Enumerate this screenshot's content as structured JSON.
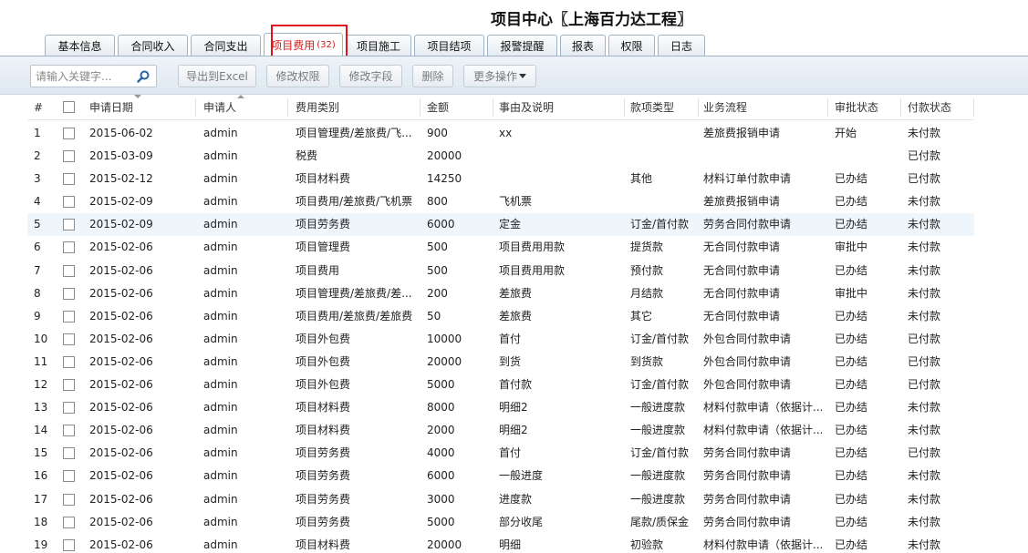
{
  "page": {
    "title": "项目中心〖上海百力达工程〗"
  },
  "tabs": [
    {
      "label": "基本信息",
      "count": ""
    },
    {
      "label": "合同收入",
      "count": ""
    },
    {
      "label": "合同支出",
      "count": ""
    },
    {
      "label": "项目费用",
      "count": "(32)",
      "active": true
    },
    {
      "label": "项目施工",
      "count": ""
    },
    {
      "label": "项目结项",
      "count": ""
    },
    {
      "label": "报警提醒",
      "count": ""
    },
    {
      "label": "报表",
      "count": ""
    },
    {
      "label": "权限",
      "count": ""
    },
    {
      "label": "日志",
      "count": ""
    }
  ],
  "toolbar": {
    "search_placeholder": "请输入关键字...",
    "export_label": "导出到Excel",
    "permission_label": "修改权限",
    "field_label": "修改字段",
    "delete_label": "删除",
    "more_label": "更多操作"
  },
  "table": {
    "columns": [
      "#",
      "申请日期",
      "申请人",
      "费用类别",
      "金额",
      "事由及说明",
      "款项类型",
      "业务流程",
      "审批状态",
      "付款状态"
    ],
    "rows": [
      [
        "1",
        "2015-06-02",
        "admin",
        "项目管理费/差旅费/飞...",
        "900",
        "xx",
        "",
        "差旅费报销申请",
        "开始",
        "未付款"
      ],
      [
        "2",
        "2015-03-09",
        "admin",
        "税费",
        "20000",
        "",
        "",
        "",
        "",
        "已付款"
      ],
      [
        "3",
        "2015-02-12",
        "admin",
        "项目材料费",
        "14250",
        "",
        "其他",
        "材料订单付款申请",
        "已办结",
        "已付款"
      ],
      [
        "4",
        "2015-02-09",
        "admin",
        "项目费用/差旅费/飞机票",
        "800",
        "飞机票",
        "",
        "差旅费报销申请",
        "已办结",
        "未付款"
      ],
      [
        "5",
        "2015-02-09",
        "admin",
        "项目劳务费",
        "6000",
        "定金",
        "订金/首付款",
        "劳务合同付款申请",
        "已办结",
        "未付款"
      ],
      [
        "6",
        "2015-02-06",
        "admin",
        "项目管理费",
        "500",
        "项目费用用款",
        "提货款",
        "无合同付款申请",
        "审批中",
        "未付款"
      ],
      [
        "7",
        "2015-02-06",
        "admin",
        "项目费用",
        "500",
        "项目费用用款",
        "预付款",
        "无合同付款申请",
        "已办结",
        "未付款"
      ],
      [
        "8",
        "2015-02-06",
        "admin",
        "项目管理费/差旅费/差...",
        "200",
        "差旅费",
        "月结款",
        "无合同付款申请",
        "审批中",
        "未付款"
      ],
      [
        "9",
        "2015-02-06",
        "admin",
        "项目费用/差旅费/差旅费",
        "50",
        "差旅费",
        "其它",
        "无合同付款申请",
        "已办结",
        "未付款"
      ],
      [
        "10",
        "2015-02-06",
        "admin",
        "项目外包费",
        "10000",
        "首付",
        "订金/首付款",
        "外包合同付款申请",
        "已办结",
        "已付款"
      ],
      [
        "11",
        "2015-02-06",
        "admin",
        "项目外包费",
        "20000",
        "到货",
        "到货款",
        "外包合同付款申请",
        "已办结",
        "已付款"
      ],
      [
        "12",
        "2015-02-06",
        "admin",
        "项目外包费",
        "5000",
        "首付款",
        "订金/首付款",
        "外包合同付款申请",
        "已办结",
        "已付款"
      ],
      [
        "13",
        "2015-02-06",
        "admin",
        "项目材料费",
        "8000",
        "明细2",
        "一般进度款",
        "材料付款申请（依据计...",
        "已办结",
        "未付款"
      ],
      [
        "14",
        "2015-02-06",
        "admin",
        "项目材料费",
        "2000",
        "明细2",
        "一般进度款",
        "材料付款申请（依据计...",
        "已办结",
        "未付款"
      ],
      [
        "15",
        "2015-02-06",
        "admin",
        "项目劳务费",
        "4000",
        "首付",
        "订金/首付款",
        "劳务合同付款申请",
        "已办结",
        "已付款"
      ],
      [
        "16",
        "2015-02-06",
        "admin",
        "项目劳务费",
        "6000",
        "一般进度",
        "一般进度款",
        "劳务合同付款申请",
        "已办结",
        "未付款"
      ],
      [
        "17",
        "2015-02-06",
        "admin",
        "项目劳务费",
        "3000",
        "进度款",
        "一般进度款",
        "劳务合同付款申请",
        "已办结",
        "未付款"
      ],
      [
        "18",
        "2015-02-06",
        "admin",
        "项目劳务费",
        "5000",
        "部分收尾",
        "尾款/质保金",
        "劳务合同付款申请",
        "已办结",
        "未付款"
      ],
      [
        "19",
        "2015-02-06",
        "admin",
        "项目材料费",
        "20000",
        "明细",
        "初验款",
        "材料付款申请（依据计...",
        "已办结",
        "未付款"
      ]
    ],
    "highlighted_row": 5
  }
}
